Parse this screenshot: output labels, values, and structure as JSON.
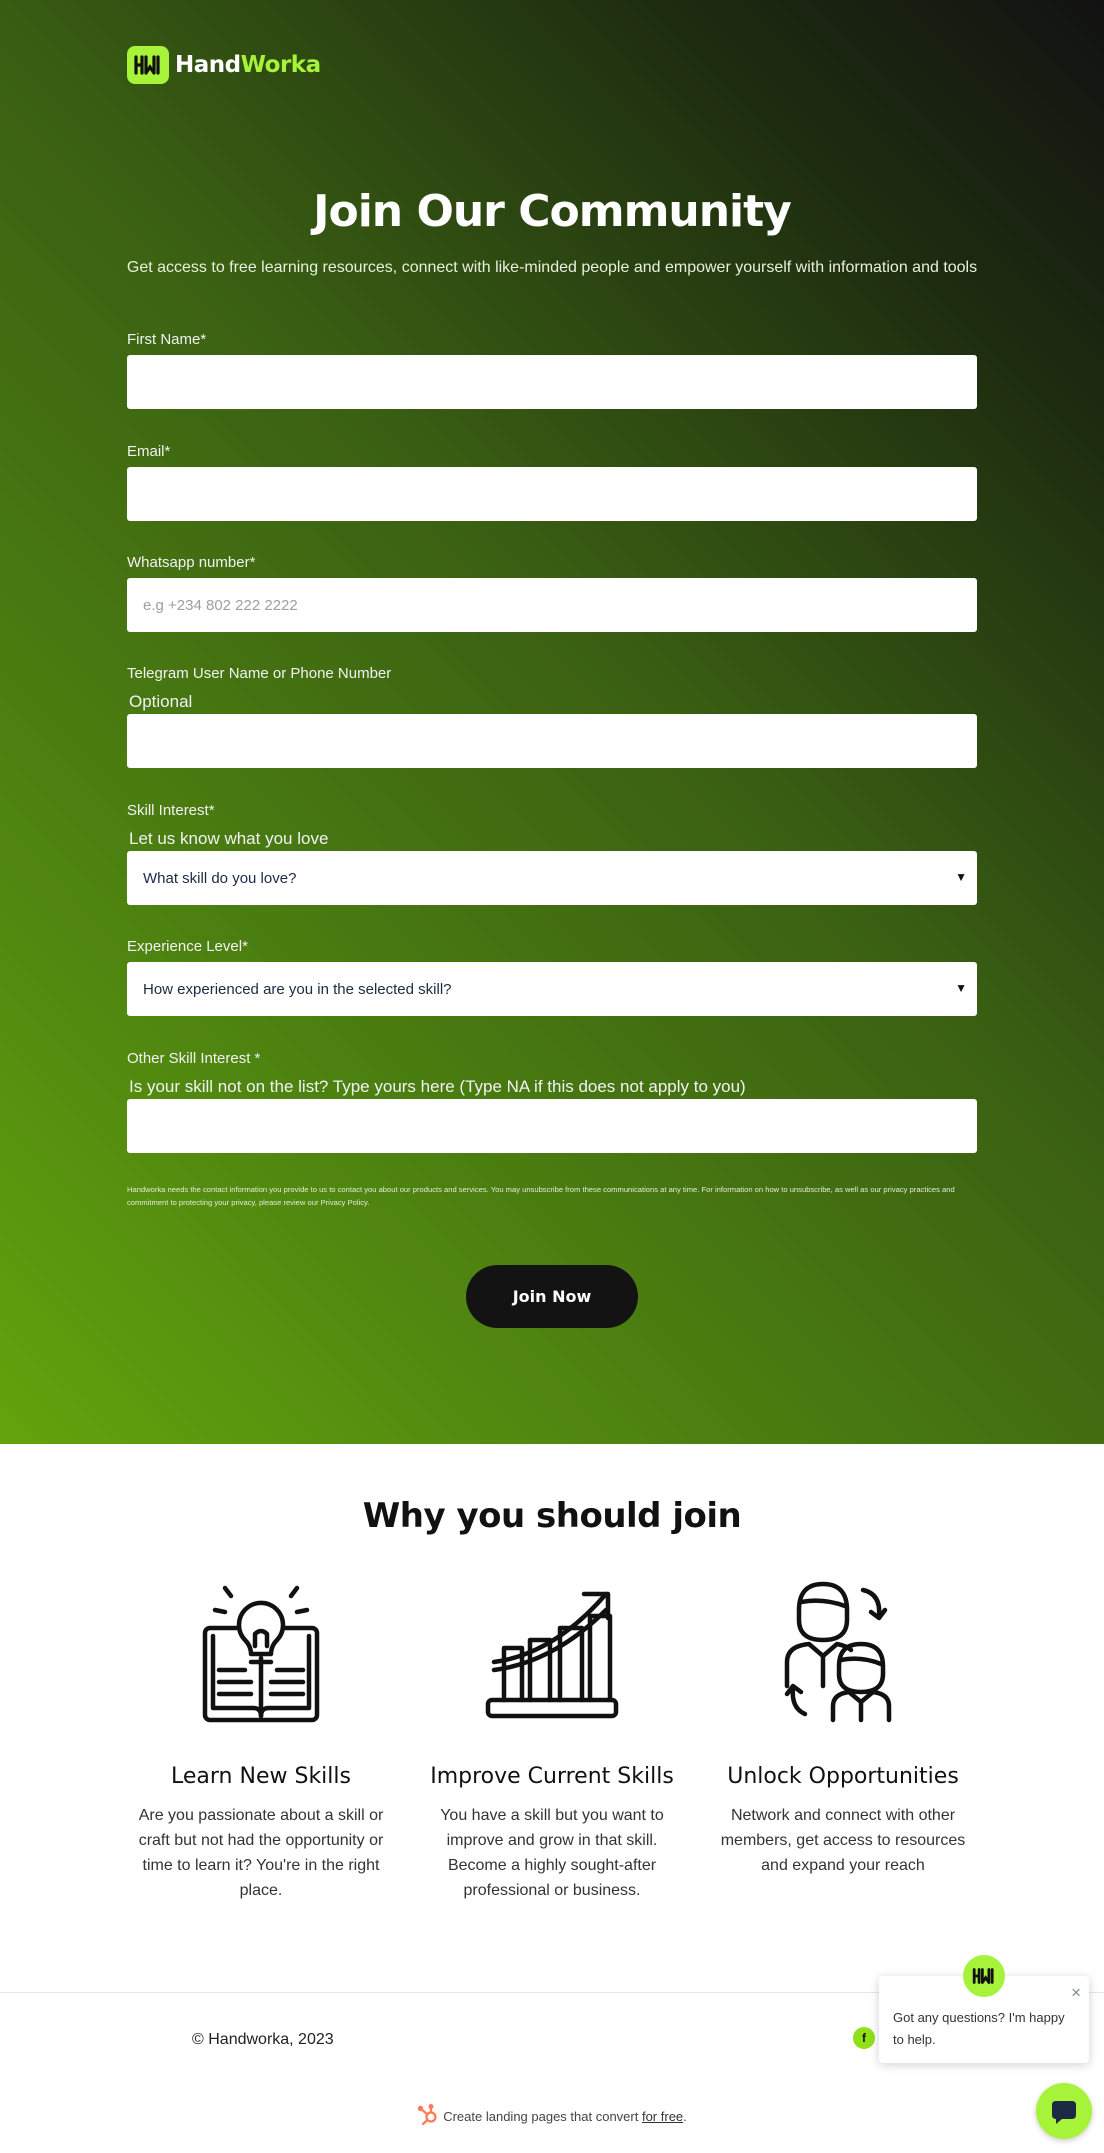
{
  "brand": {
    "name_part1": "Hand",
    "name_part2": "Worka",
    "accent": "#a6f33a",
    "icon": "handworka-logo-icon"
  },
  "hero": {
    "title": "Join Our Community",
    "subtitle": "Get access to free learning resources, connect with like-minded people and empower yourself with information and tools"
  },
  "form": {
    "first_name": {
      "label": "First Name*",
      "value": ""
    },
    "email": {
      "label": "Email*",
      "value": ""
    },
    "whatsapp": {
      "label": "Whatsapp number*",
      "placeholder": "e.g +234 802 222 2222",
      "value": ""
    },
    "telegram": {
      "label": "Telegram  User Name or  Phone Number",
      "hint": "Optional",
      "value": ""
    },
    "skill_interest": {
      "label": "Skill Interest*",
      "hint": "Let us know what you love",
      "selected": "What skill do you love?"
    },
    "experience": {
      "label": "Experience Level*",
      "selected": "How experienced are you in the selected skill?"
    },
    "other_skill": {
      "label": "Other Skill Interest *",
      "hint": "Is your skill not on the list? Type yours here (Type NA if this does not apply to you)",
      "value": ""
    },
    "privacy": "Handworka needs the contact information you provide to us to contact you about our products and services. You may unsubscribe from these communications at any time. For information on how to unsubscribe, as well as our privacy practices and commitment to protecting your privacy, please review our Privacy Policy.",
    "submit": "Join Now"
  },
  "why": {
    "title": "Why you should join",
    "features": [
      {
        "icon": "lightbulb-book-icon",
        "title": "Learn New Skills",
        "text": "Are you passionate about a skill or craft but not had the opportunity or time to learn it? You're in the right place."
      },
      {
        "icon": "growth-chart-icon",
        "title": "Improve Current Skills",
        "text": "You have a skill but you want to improve and grow in that skill. Become a highly sought-after professional or business."
      },
      {
        "icon": "network-people-icon",
        "title": "Unlock Opportunities",
        "text": "Network and connect with other members, get access to resources and expand your reach"
      }
    ]
  },
  "footer": {
    "copyright": "© Handworka, 2023",
    "social": "f",
    "hubspot_text": "Create landing pages that convert ",
    "hubspot_link": "for free",
    "hubspot_end": "."
  },
  "chat": {
    "message": "Got any questions? I'm happy to help.",
    "close": "×"
  }
}
